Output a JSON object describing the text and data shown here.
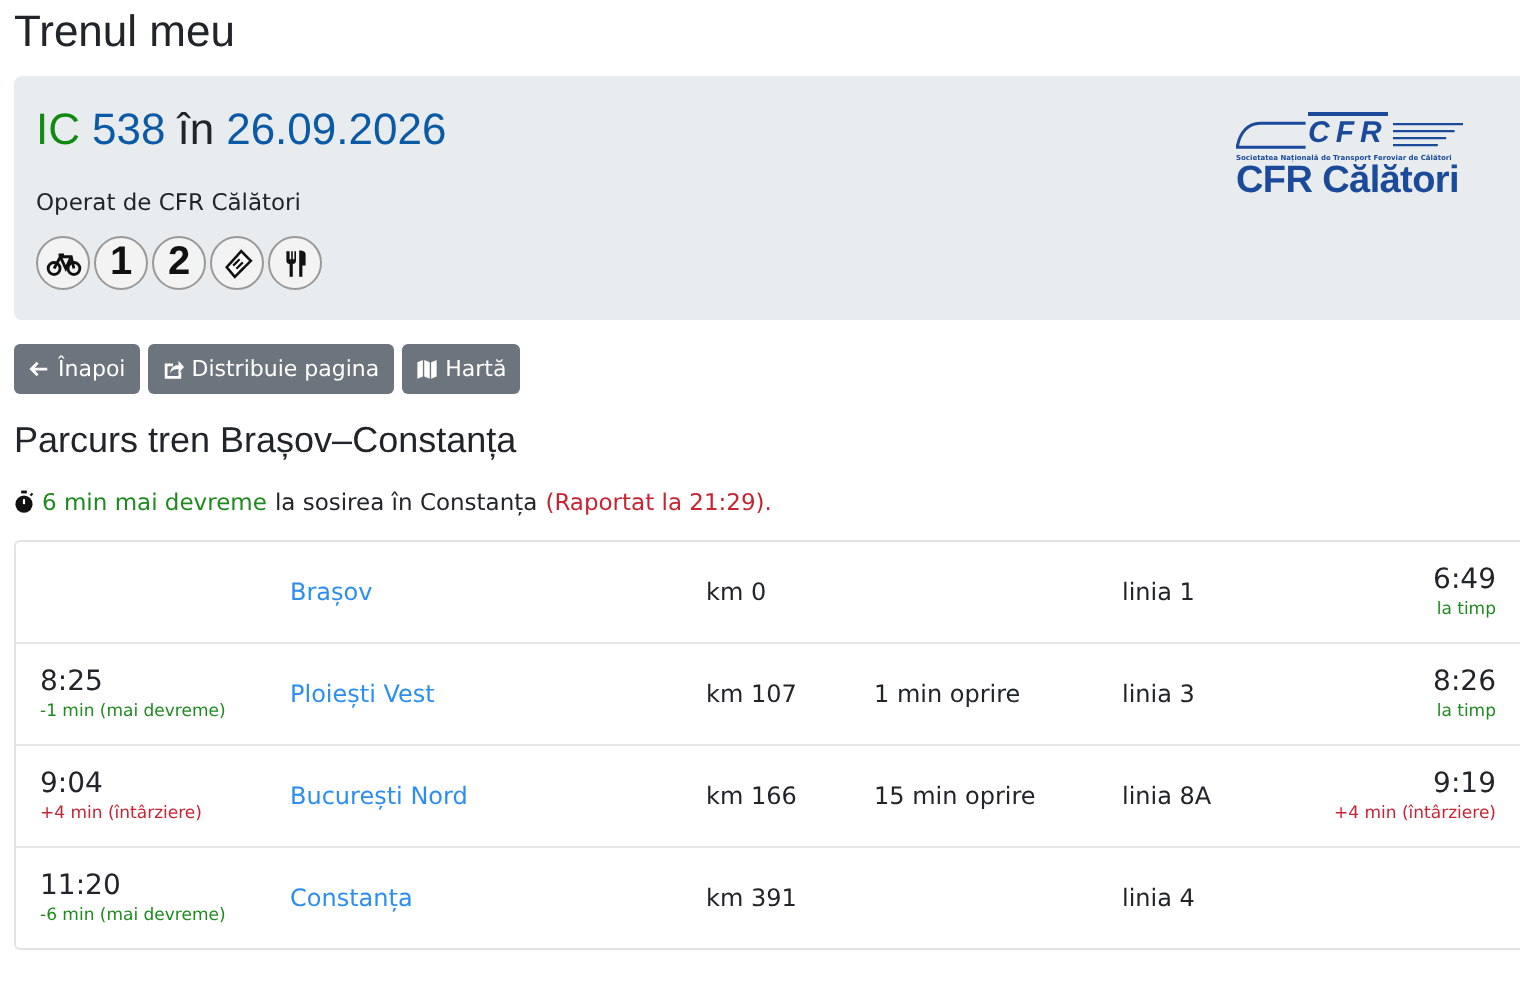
{
  "page_title": "Trenul meu",
  "train": {
    "category": "IC",
    "number": "538",
    "connector": "în",
    "date": "26.09.2026",
    "operator": "Operat de CFR Călători",
    "amenities": [
      {
        "kind": "bike"
      },
      {
        "kind": "text",
        "label": "1"
      },
      {
        "kind": "text",
        "label": "2"
      },
      {
        "kind": "ticket"
      },
      {
        "kind": "restaurant"
      }
    ],
    "logo": {
      "mark": "CFR",
      "tagline": "Societatea Națională de Transport Feroviar de Călători",
      "name": "CFR Călători"
    }
  },
  "buttons": [
    {
      "kind": "back",
      "label": "Înapoi"
    },
    {
      "kind": "share",
      "label": "Distribuie pagina"
    },
    {
      "kind": "map",
      "label": "Hartă"
    }
  ],
  "route_heading": "Parcurs tren Brașov–Constanța",
  "report": {
    "delay": "6 min mai devreme",
    "color": "#1e8a1e",
    "text": "la sosirea în Constanța",
    "reported": "(Raportat la 21:29)."
  },
  "stops": [
    {
      "station": "Brașov",
      "km": "km 0",
      "platform": "linia 1",
      "departure": {
        "time": "6:49",
        "delay": "la timp",
        "color": "#1e8a1e"
      }
    },
    {
      "arrival": {
        "time": "8:25",
        "delay": "-1 min (mai devreme)",
        "color": "#1e8a1e"
      },
      "station": "Ploiești Vest",
      "km": "km 107",
      "stop": "1 min oprire",
      "platform": "linia 3",
      "departure": {
        "time": "8:26",
        "delay": "la timp",
        "color": "#1e8a1e"
      }
    },
    {
      "arrival": {
        "time": "9:04",
        "delay": "+4 min (întârziere)",
        "color": "#c82333"
      },
      "station": "București Nord",
      "km": "km 166",
      "stop": "15 min oprire",
      "platform": "linia 8A",
      "departure": {
        "time": "9:19",
        "delay": "+4 min (întârziere)",
        "color": "#c82333"
      }
    },
    {
      "arrival": {
        "time": "11:20",
        "delay": "-6 min (mai devreme)",
        "color": "#1e8a1e"
      },
      "station": "Constanța",
      "km": "km 391",
      "platform": "linia 4"
    }
  ]
}
